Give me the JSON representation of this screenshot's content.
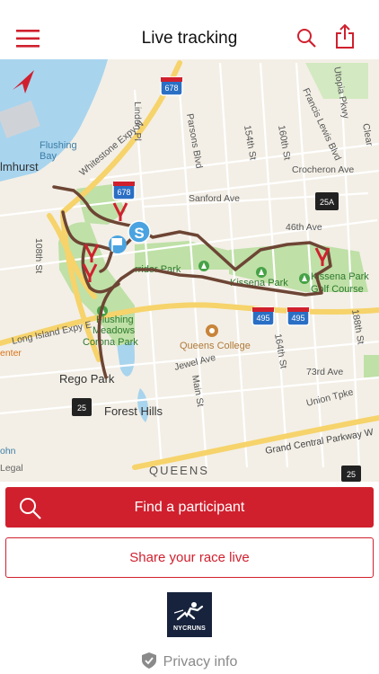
{
  "header": {
    "title": "Live tracking"
  },
  "icons": {
    "menu": "hamburger-menu-icon",
    "search": "search-icon",
    "share": "share-icon",
    "locate": "location-arrow-icon"
  },
  "map": {
    "labels": {
      "flushing_bay": "Flushing\nBay",
      "elmhurst": "lmhurst",
      "whitestone": "Whitestone Expy N",
      "linden": "Linden Pl",
      "parsons": "Parsons Blvd",
      "st154": "154th St",
      "st160": "160th St",
      "utopia": "Utopia Pkwy",
      "francis": "Francis Lewis Blvd",
      "crocheron": "Crocheron Ave",
      "sanford": "Sanford Ave",
      "ave46": "46th Ave",
      "st108": "108th St",
      "corridor": "rridor Park",
      "kissena": "Kissena Park",
      "kissena_gc1": "Kissena Park",
      "kissena_gc2": "Golf Course",
      "fmcp1": "Flushing",
      "fmcp2": "Meadows",
      "fmcp3": "Corona Park",
      "lie": "Long Island Expy E",
      "queens_college": "Queens College",
      "rego": "Rego Park",
      "forest": "Forest Hills",
      "jewel": "Jewel Ave",
      "main": "Main St",
      "st164": "164th St",
      "ave73": "73rd Ave",
      "union": "Union Tpke",
      "gcp": "Grand Central Parkway W",
      "queens": "QUEENS",
      "st188": "188th St",
      "clear": "Clear",
      "center": "enter",
      "john": "ohn",
      "legal": "Legal"
    },
    "shields": {
      "i678a": "678",
      "i678b": "678",
      "i495a": "495",
      "i495b": "495",
      "r25a": "25A",
      "r25b": "25",
      "r25c": "25"
    },
    "start_marker": "S"
  },
  "actions": {
    "find": "Find a participant",
    "share": "Share your race live"
  },
  "brand": {
    "logo_text": "NYCRUNS"
  },
  "footer": {
    "privacy": "Privacy info"
  },
  "colors": {
    "accent": "#d0202e",
    "route": "#6d4534",
    "water": "#a8d4ee",
    "park": "#bfe0a7",
    "highway": "#f6d36b",
    "logo_bg": "#17233c"
  }
}
